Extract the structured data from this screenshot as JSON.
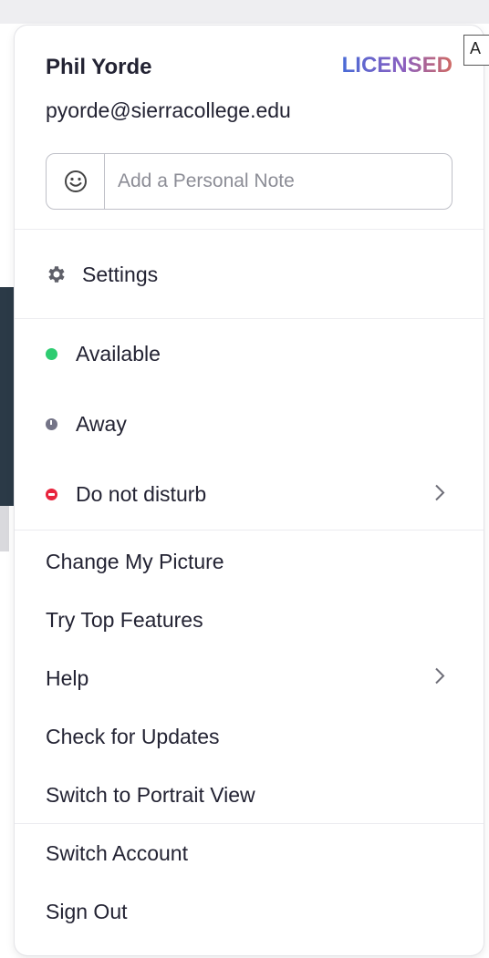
{
  "tooltip_partial": "A",
  "profile": {
    "name": "Phil Yorde",
    "license": "LICENSED",
    "email": "pyorde@sierracollege.edu",
    "note_placeholder": "Add a Personal Note",
    "note_icon": "smiley-icon"
  },
  "settings": {
    "label": "Settings",
    "icon": "gear-icon"
  },
  "status_items": [
    {
      "label": "Available",
      "color": "#2ecc71"
    },
    {
      "label": "Away",
      "color": "#747487"
    },
    {
      "label": "Do not disturb",
      "color": "#e8243d",
      "has_submenu": true
    }
  ],
  "misc_items": [
    {
      "label": "Change My Picture"
    },
    {
      "label": "Try Top Features"
    },
    {
      "label": "Help",
      "has_submenu": true
    },
    {
      "label": "Check for Updates"
    },
    {
      "label": "Switch to Portrait View"
    }
  ],
  "account_items": [
    {
      "label": "Switch Account"
    },
    {
      "label": "Sign Out"
    }
  ]
}
